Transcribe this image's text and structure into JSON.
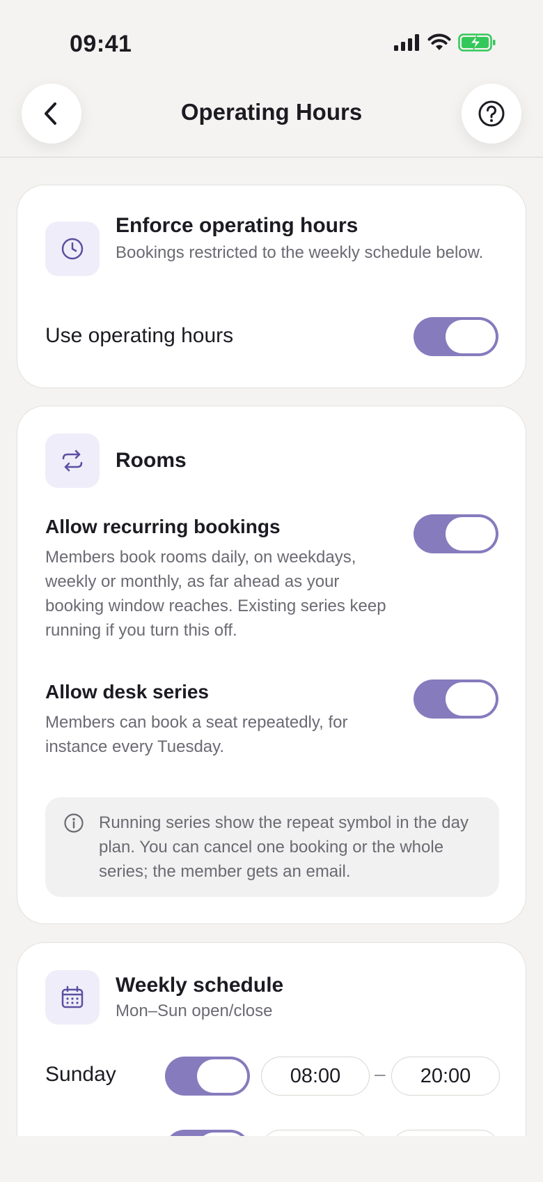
{
  "status_bar": {
    "time": "09:41",
    "icons": [
      "signal-icon",
      "wifi-icon",
      "battery-charging-icon"
    ],
    "battery_color": "#34c759"
  },
  "nav": {
    "title": "Operating Hours",
    "back_icon": "chevron-left-icon",
    "help_icon": "help-circle-icon"
  },
  "enforce_card": {
    "icon": "clock-icon",
    "title": "Enforce operating hours",
    "subtitle": "Bookings restricted to the weekly schedule below.",
    "toggle_label": "Use operating hours",
    "toggle_on": true
  },
  "rooms_card": {
    "icon": "repeat-icon",
    "title": "Rooms",
    "recurring": {
      "title": "Allow recurring bookings",
      "description": "Members book rooms daily, on weekdays, weekly or monthly, as far ahead as your booking window reaches. Existing series keep running if you turn this off.",
      "on": true
    },
    "desk_series": {
      "title": "Allow desk series",
      "description": "Members can book a seat repeatedly, for instance every Tuesday.",
      "on": true
    },
    "info": {
      "icon": "info-icon",
      "text": "Running series show the repeat symbol in the day plan. You can cancel one booking or the whole series; the member gets an email."
    }
  },
  "schedule_card": {
    "icon": "calendar-icon",
    "title": "Weekly schedule",
    "subtitle": "Mon–Sun open/close",
    "days": [
      {
        "name": "Sunday",
        "on": true,
        "open": "08:00",
        "close": "20:00",
        "separator": "–"
      }
    ]
  },
  "colors": {
    "accent": "#857bbd",
    "icon_tint": "#5a50a0",
    "icon_tile_bg": "#efedf9",
    "background": "#f4f3f1"
  }
}
